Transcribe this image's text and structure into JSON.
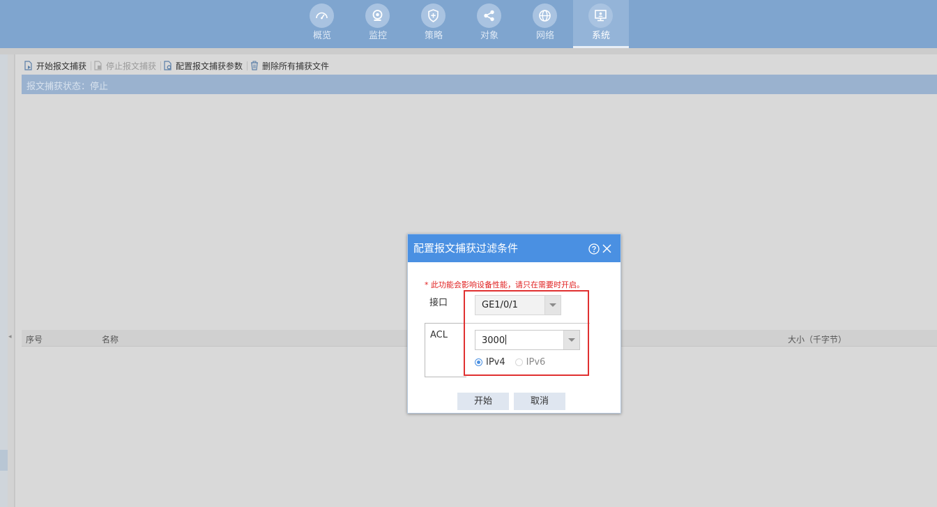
{
  "nav": {
    "items": [
      {
        "label": "概览",
        "icon": "dashboard-gauge-icon"
      },
      {
        "label": "监控",
        "icon": "camera-icon"
      },
      {
        "label": "策略",
        "icon": "shield-plus-icon"
      },
      {
        "label": "对象",
        "icon": "share-nodes-icon"
      },
      {
        "label": "网络",
        "icon": "globe-icon"
      },
      {
        "label": "系统",
        "icon": "monitor-icon"
      }
    ],
    "active": "系统"
  },
  "toolbar": {
    "start_capture": "开始报文捕获",
    "stop_capture": "停止报文捕获",
    "config_params": "配置报文捕获参数",
    "delete_all": "删除所有捕获文件"
  },
  "status": {
    "text": "报文捕获状态：停止"
  },
  "table": {
    "columns": {
      "index": "序号",
      "name": "名称",
      "size": "大小（千字节）"
    }
  },
  "dialog": {
    "title": "配置报文捕获过滤条件",
    "warning": "* 此功能会影响设备性能，请只在需要时开启。",
    "interface_label": "接口",
    "interface_value": "GE1/0/1",
    "acl_label": "ACL",
    "acl_value": "3000",
    "ip_options": [
      "IPv4",
      "IPv6"
    ],
    "ip_selected": "IPv4",
    "start_button": "开始",
    "cancel_button": "取消"
  },
  "colors": {
    "nav_bg": "#7fa5cf",
    "dialog_title_bg": "#4a90e2",
    "highlight": "#e03030",
    "warning": "#e02020"
  }
}
